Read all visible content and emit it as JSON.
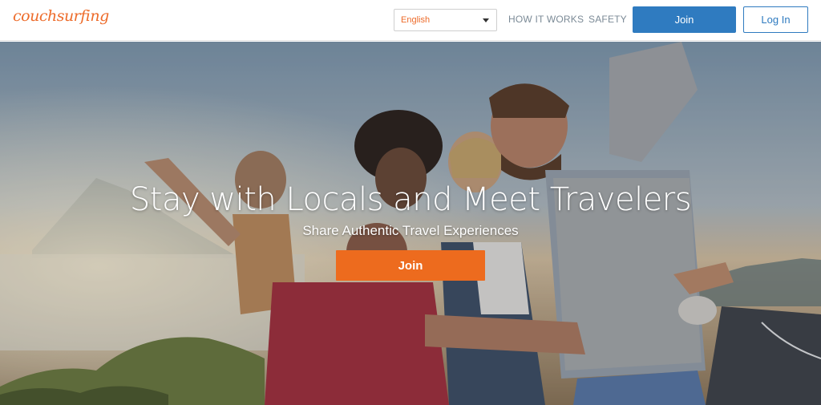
{
  "header": {
    "logo_text": "couchsurfing",
    "language_select": {
      "selected": "English"
    },
    "nav": {
      "how_it_works": "HOW IT WORKS",
      "safety": "SAFETY"
    },
    "join_label": "Join",
    "login_label": "Log In"
  },
  "hero": {
    "title": "Stay with Locals and Meet Travelers",
    "subtitle": "Share Authentic Travel Experiences",
    "join_label": "Join"
  },
  "colors": {
    "brand_orange": "#ed6b1e",
    "brand_blue": "#2f7bc0"
  },
  "icons": {
    "language_caret": "caret-down-icon"
  }
}
